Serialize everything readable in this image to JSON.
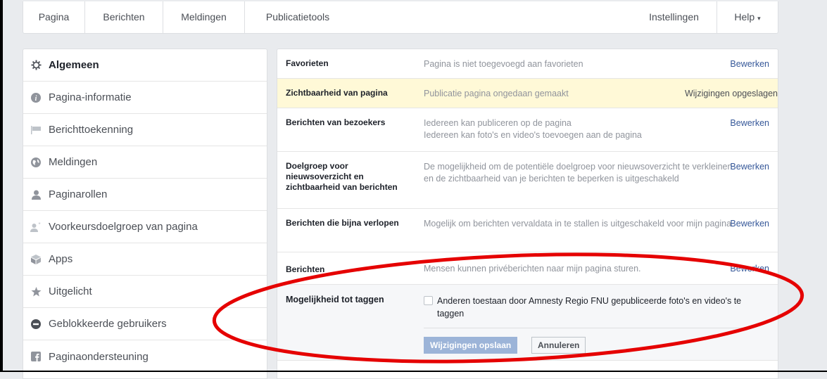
{
  "topnav": {
    "tabs": [
      "Pagina",
      "Berichten",
      "Meldingen",
      "Publicatietools"
    ],
    "settings_label": "Instellingen",
    "help_label": "Help",
    "help_caret": "▾"
  },
  "sidebar": {
    "items": [
      {
        "label": "Algemeen",
        "icon": "gear-icon"
      },
      {
        "label": "Pagina-informatie",
        "icon": "info-icon"
      },
      {
        "label": "Berichttoekenning",
        "icon": "flag-icon"
      },
      {
        "label": "Meldingen",
        "icon": "globe-icon"
      },
      {
        "label": "Paginarollen",
        "icon": "person-icon"
      },
      {
        "label": "Voorkeursdoelgroep van pagina",
        "icon": "person-star-icon"
      },
      {
        "label": "Apps",
        "icon": "cube-icon"
      },
      {
        "label": "Uitgelicht",
        "icon": "star-icon"
      },
      {
        "label": "Geblokkeerde gebruikers",
        "icon": "block-icon"
      },
      {
        "label": "Paginaondersteuning",
        "icon": "facebook-icon"
      }
    ]
  },
  "settings": {
    "favorites": {
      "label": "Favorieten",
      "value": "Pagina is niet toegevoegd aan favorieten",
      "action": "Bewerken"
    },
    "visibility": {
      "label": "Zichtbaarheid van pagina",
      "value": "Publicatie pagina ongedaan gemaakt",
      "action": "Wijzigingen opgeslagen"
    },
    "visitor_posts": {
      "label": "Berichten van bezoekers",
      "value_1": "Iedereen kan publiceren op de pagina",
      "value_2": "Iedereen kan foto's en video's toevoegen aan de pagina",
      "action": "Bewerken"
    },
    "audience": {
      "label_1": "Doelgroep voor",
      "label_2": "nieuwsoverzicht en",
      "label_3": "zichtbaarheid van berichten",
      "value": "De mogelijkheid om de potentiële doelgroep voor nieuwsoverzicht te verkleinen en de zichtbaarheid van je berichten te beperken is uitgeschakeld",
      "action": "Bewerken"
    },
    "expiring": {
      "label": "Berichten die bijna verlopen",
      "value": "Mogelijk om berichten vervaldata in te stallen is uitgeschakeld voor mijn pagina",
      "action": "Bewerken"
    },
    "messages": {
      "label": "Berichten",
      "value": "Mensen kunnen privéberichten naar mijn pagina sturen.",
      "action": "Bewerken"
    },
    "tagging": {
      "label": "Mogelijkheid tot taggen",
      "checkbox_label": "Anderen toestaan door Amnesty Regio FNU gepubliceerde foto's en video's te taggen",
      "checked": false,
      "save_label": "Wijzigingen opslaan",
      "cancel_label": "Annuleren"
    }
  },
  "colors": {
    "annotation": "#e50000",
    "highlight": "#fff9d7",
    "link": "#365899"
  }
}
